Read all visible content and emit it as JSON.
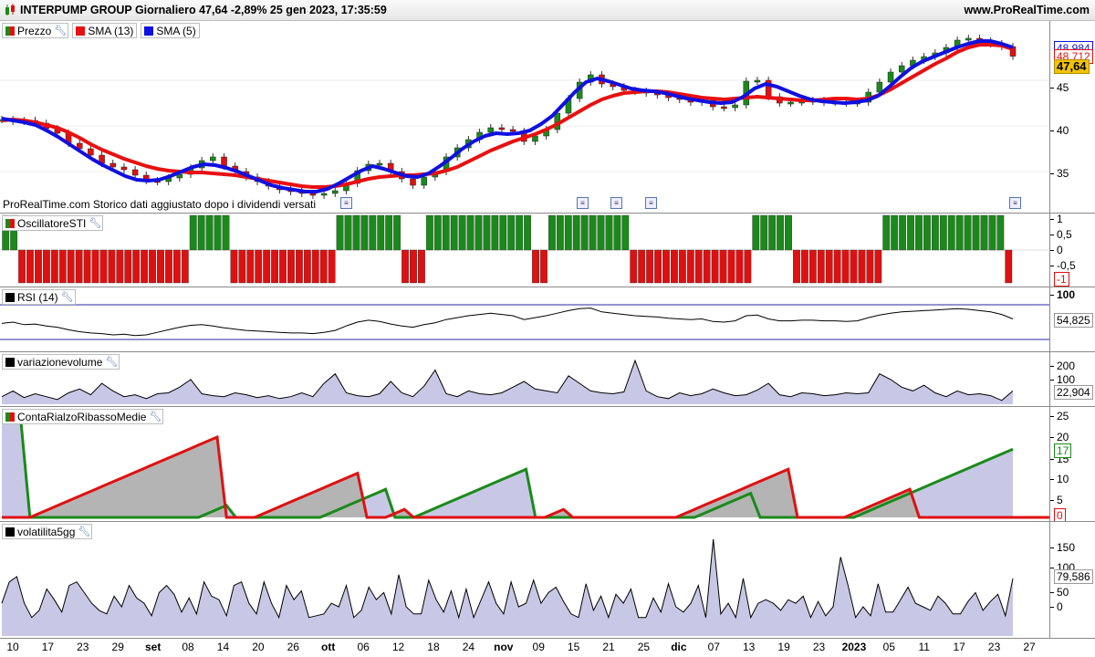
{
  "header": {
    "title": "INTERPUMP GROUP Giornaliero 47,64 -2,89% 25 gen 2023, 17:35:59",
    "site": "www.ProRealTime.com"
  },
  "colors": {
    "up": "#1a8a1a",
    "down": "#e01010",
    "sma13": "#e81010",
    "sma5": "#1010e0",
    "fill": "#c8c8e6"
  },
  "price_panel": {
    "legend": [
      {
        "label": "Prezzo",
        "color": "#1a8a1a"
      },
      {
        "label": "SMA (13)",
        "color": "#e81010"
      },
      {
        "label": "SMA (5)",
        "color": "#1010e0"
      }
    ],
    "footnote": "ProRealTime.com Storico dati aggiustato dopo i dividendi versati",
    "yticks": [
      "45",
      "40",
      "35"
    ],
    "labels": {
      "top": "48,984",
      "mid": "48,712",
      "last": "47,64"
    }
  },
  "sti_panel": {
    "name": "OscillatoreSTI",
    "yticks": [
      "1",
      "0,5",
      "0",
      "-0,5"
    ],
    "last": "-1"
  },
  "rsi_panel": {
    "name": "RSI (14)",
    "yticks": [
      "100"
    ],
    "last": "54,825"
  },
  "vol_panel": {
    "name": "variazionevolume",
    "yticks": [
      "200",
      "100"
    ],
    "last": "22,904"
  },
  "conta_panel": {
    "name": "ContaRialzoRibassoMedie",
    "yticks": [
      "25",
      "20",
      "15",
      "10",
      "5"
    ],
    "last_up": "17",
    "last_down": "0"
  },
  "volat_panel": {
    "name": "volatilita5gg",
    "yticks": [
      "150",
      "100",
      "50",
      "0"
    ],
    "last": "79,586"
  },
  "xaxis": [
    {
      "t": "10",
      "b": false
    },
    {
      "t": "17",
      "b": false
    },
    {
      "t": "23",
      "b": false
    },
    {
      "t": "29",
      "b": false
    },
    {
      "t": "set",
      "b": true
    },
    {
      "t": "08",
      "b": false
    },
    {
      "t": "14",
      "b": false
    },
    {
      "t": "20",
      "b": false
    },
    {
      "t": "26",
      "b": false
    },
    {
      "t": "ott",
      "b": true
    },
    {
      "t": "06",
      "b": false
    },
    {
      "t": "12",
      "b": false
    },
    {
      "t": "18",
      "b": false
    },
    {
      "t": "24",
      "b": false
    },
    {
      "t": "nov",
      "b": true
    },
    {
      "t": "09",
      "b": false
    },
    {
      "t": "15",
      "b": false
    },
    {
      "t": "21",
      "b": false
    },
    {
      "t": "25",
      "b": false
    },
    {
      "t": "dic",
      "b": true
    },
    {
      "t": "07",
      "b": false
    },
    {
      "t": "13",
      "b": false
    },
    {
      "t": "19",
      "b": false
    },
    {
      "t": "23",
      "b": false
    },
    {
      "t": "2023",
      "b": true
    },
    {
      "t": "05",
      "b": false
    },
    {
      "t": "11",
      "b": false
    },
    {
      "t": "17",
      "b": false
    },
    {
      "t": "23",
      "b": false
    },
    {
      "t": "27",
      "b": false
    }
  ],
  "chart_data": [
    {
      "type": "line",
      "title": "INTERPUMP GROUP Giornaliero",
      "ylim": [
        30,
        50
      ],
      "series": [
        {
          "name": "Prezzo",
          "values": [
            40.7,
            40.5,
            40.6,
            40.3,
            39.7,
            39.2,
            38.1,
            37.5,
            36.8,
            35.9,
            35.5,
            35.2,
            34.6,
            34.0,
            33.9,
            34.3,
            34.7,
            35.4,
            36.2,
            36.6,
            35.6,
            35.0,
            34.4,
            33.9,
            33.4,
            33.0,
            32.8,
            32.6,
            32.4,
            32.6,
            32.9,
            33.7,
            35.1,
            35.8,
            35.9,
            35.0,
            34.2,
            33.5,
            34.4,
            35.0,
            36.6,
            37.6,
            38.5,
            39.3,
            39.8,
            39.6,
            39.4,
            38.3,
            38.9,
            39.6,
            41.4,
            43.0,
            44.8,
            45.6,
            44.6,
            44.3,
            43.9,
            43.8,
            43.6,
            43.4,
            43.1,
            42.9,
            42.6,
            42.8,
            42.1,
            42.0,
            42.3,
            44.9,
            45.0,
            43.2,
            42.5,
            42.6,
            42.7,
            42.8,
            42.6,
            42.6,
            42.5,
            42.6,
            43.7,
            44.8,
            45.9,
            46.6,
            47.2,
            47.6,
            48.0,
            48.6,
            49.4,
            49.6,
            49.3,
            49.0,
            48.7,
            47.64
          ]
        },
        {
          "name": "SMA (13)",
          "values": [
            40.6,
            40.7,
            40.6,
            40.4,
            40.1,
            39.8,
            39.3,
            38.7,
            38.0,
            37.4,
            36.9,
            36.4,
            36.0,
            35.6,
            35.3,
            35.1,
            35.0,
            34.9,
            34.9,
            34.8,
            34.7,
            34.6,
            34.4,
            34.2,
            34.0,
            33.8,
            33.6,
            33.4,
            33.3,
            33.3,
            33.4,
            33.6,
            33.9,
            34.2,
            34.4,
            34.5,
            34.6,
            34.6,
            34.7,
            34.8,
            35.1,
            35.5,
            36.1,
            36.7,
            37.3,
            37.8,
            38.3,
            38.7,
            39.1,
            39.6,
            40.2,
            40.9,
            41.6,
            42.3,
            42.9,
            43.3,
            43.6,
            43.7,
            43.8,
            43.8,
            43.7,
            43.5,
            43.3,
            43.1,
            43.0,
            42.9,
            43.0,
            43.1,
            43.2,
            43.1,
            43.0,
            42.9,
            42.8,
            42.8,
            42.9,
            43.0,
            43.0,
            42.9,
            43.0,
            43.4,
            44.0,
            44.7,
            45.4,
            46.1,
            46.8,
            47.4,
            48.1,
            48.6,
            48.9,
            48.9,
            48.8,
            48.4
          ]
        },
        {
          "name": "SMA (5)",
          "values": [
            40.8,
            40.6,
            40.4,
            40.1,
            39.5,
            38.8,
            38.0,
            37.2,
            36.4,
            35.7,
            35.1,
            34.5,
            34.1,
            34.0,
            34.1,
            34.5,
            35.0,
            35.5,
            35.8,
            35.7,
            35.4,
            35.0,
            34.5,
            34.0,
            33.5,
            33.2,
            33.0,
            32.8,
            32.8,
            33.1,
            33.7,
            34.4,
            35.1,
            35.6,
            35.3,
            34.9,
            34.5,
            34.4,
            34.8,
            35.6,
            36.5,
            37.5,
            38.3,
            38.9,
            39.2,
            39.1,
            39.2,
            39.5,
            40.2,
            41.1,
            42.4,
            43.7,
            44.8,
            45.2,
            44.9,
            44.5,
            44.1,
            43.9,
            43.8,
            43.6,
            43.3,
            43.0,
            42.8,
            42.6,
            42.5,
            42.6,
            43.2,
            44.1,
            44.6,
            44.3,
            43.8,
            43.3,
            42.9,
            42.7,
            42.6,
            42.5,
            42.6,
            42.8,
            43.3,
            44.3,
            45.4,
            46.4,
            47.1,
            47.6,
            48.1,
            48.6,
            49.0,
            49.3,
            49.3,
            49.0,
            48.6
          ]
        }
      ]
    },
    {
      "type": "bar",
      "title": "OscillatoreSTI",
      "ylim": [
        -1,
        1
      ],
      "values": [
        1,
        1,
        -1,
        -1,
        -1,
        -1,
        -1,
        -1,
        -1,
        -1,
        -1,
        -1,
        -1,
        -1,
        -1,
        -1,
        -1,
        -1,
        -1,
        -1,
        -1,
        -1,
        -1,
        1,
        1,
        1,
        1,
        1,
        -1,
        -1,
        -1,
        -1,
        -1,
        -1,
        -1,
        -1,
        -1,
        -1,
        -1,
        -1,
        -1,
        1,
        1,
        1,
        1,
        1,
        1,
        1,
        1,
        -1,
        -1,
        -1,
        1,
        1,
        1,
        1,
        1,
        1,
        1,
        1,
        1,
        1,
        1,
        1,
        1,
        -1,
        -1,
        1,
        1,
        1,
        1,
        1,
        1,
        1,
        1,
        1,
        1,
        -1,
        -1,
        -1,
        -1,
        -1,
        -1,
        -1,
        -1,
        -1,
        -1,
        -1,
        -1,
        -1,
        -1,
        -1,
        1,
        1,
        1,
        1,
        1,
        -1,
        -1,
        -1,
        -1,
        -1,
        -1,
        -1,
        -1,
        -1,
        -1,
        -1,
        1,
        1,
        1,
        1,
        1,
        1,
        1,
        1,
        1,
        1,
        1,
        1,
        1,
        1,
        1,
        -1
      ]
    },
    {
      "type": "line",
      "title": "RSI (14)",
      "ylim": [
        0,
        100
      ],
      "series": [
        {
          "name": "RSI (14)",
          "values": [
            48,
            50,
            46,
            47,
            44,
            42,
            38,
            35,
            33,
            32,
            30,
            31,
            29,
            30,
            34,
            38,
            42,
            45,
            46,
            44,
            41,
            39,
            37,
            36,
            35,
            34,
            33,
            33,
            32,
            34,
            37,
            44,
            50,
            53,
            51,
            47,
            44,
            42,
            46,
            49,
            54,
            57,
            60,
            62,
            64,
            62,
            60,
            54,
            57,
            60,
            64,
            68,
            71,
            72,
            66,
            64,
            62,
            60,
            59,
            58,
            56,
            55,
            54,
            55,
            51,
            50,
            52,
            60,
            61,
            55,
            52,
            52,
            53,
            53,
            52,
            52,
            51,
            52,
            57,
            61,
            64,
            66,
            67,
            68,
            69,
            70,
            71,
            70,
            68,
            66,
            62,
            55
          ]
        }
      ]
    },
    {
      "type": "area",
      "title": "variazionevolume",
      "series": [
        {
          "name": "variazionevolume",
          "values": [
            40,
            70,
            35,
            55,
            40,
            25,
            60,
            80,
            50,
            110,
            70,
            40,
            50,
            30,
            55,
            60,
            90,
            130,
            55,
            45,
            40,
            60,
            50,
            35,
            45,
            30,
            40,
            60,
            40,
            110,
            160,
            60,
            45,
            40,
            55,
            120,
            60,
            40,
            95,
            180,
            55,
            40,
            70,
            55,
            50,
            60,
            90,
            120,
            80,
            70,
            60,
            150,
            110,
            70,
            60,
            55,
            65,
            230,
            70,
            40,
            30,
            60,
            45,
            55,
            80,
            60,
            45,
            50,
            75,
            110,
            50,
            40,
            60,
            55,
            45,
            50,
            60,
            55,
            60,
            160,
            130,
            90,
            70,
            100,
            60,
            40,
            70,
            50,
            55,
            45,
            20,
            70
          ]
        }
      ]
    },
    {
      "type": "area",
      "title": "ContaRialzoRibassoMedie",
      "ylim": [
        0,
        25
      ],
      "series": [
        {
          "name": "rialzo",
          "values": [
            25,
            25,
            25,
            0,
            0,
            0,
            0,
            0,
            0,
            0,
            0,
            0,
            0,
            0,
            0,
            0,
            0,
            0,
            0,
            0,
            0,
            0,
            1,
            2,
            3,
            0,
            0,
            0,
            0,
            0,
            0,
            0,
            0,
            0,
            0,
            1,
            2,
            3,
            4,
            5,
            6,
            7,
            0,
            0,
            0,
            1,
            2,
            3,
            4,
            5,
            6,
            7,
            8,
            9,
            10,
            11,
            12,
            0,
            0,
            0,
            0,
            0,
            0,
            0,
            0,
            0,
            0,
            0,
            0,
            0,
            0,
            0,
            0,
            0,
            0,
            1,
            2,
            3,
            4,
            5,
            6,
            0,
            0,
            0,
            0,
            0,
            0,
            0,
            0,
            0,
            0,
            0,
            1,
            2,
            3,
            4,
            5,
            6,
            7,
            8,
            9,
            10,
            11,
            12,
            13,
            14,
            15,
            16,
            17
          ]
        },
        {
          "name": "ribasso",
          "values": [
            0,
            0,
            0,
            0,
            1,
            2,
            3,
            4,
            5,
            6,
            7,
            8,
            9,
            10,
            11,
            12,
            13,
            14,
            15,
            16,
            17,
            18,
            19,
            20,
            0,
            0,
            0,
            0,
            1,
            2,
            3,
            4,
            5,
            6,
            7,
            8,
            9,
            10,
            11,
            0,
            0,
            0,
            1,
            2,
            0,
            0,
            0,
            0,
            0,
            0,
            0,
            0,
            0,
            0,
            0,
            0,
            0,
            0,
            0,
            1,
            2,
            0,
            0,
            0,
            0,
            0,
            0,
            0,
            0,
            0,
            0,
            0,
            0,
            1,
            2,
            3,
            4,
            5,
            6,
            7,
            8,
            9,
            10,
            11,
            12,
            0,
            0,
            0,
            0,
            0,
            0,
            1,
            2,
            3,
            4,
            5,
            6,
            7,
            0,
            0,
            0,
            0,
            0,
            0,
            0,
            0,
            0,
            0,
            0,
            0,
            0,
            0,
            0,
            0
          ]
        }
      ]
    },
    {
      "type": "area",
      "title": "volatilita5gg",
      "series": [
        {
          "name": "volatilita5gg",
          "values": [
            10,
            70,
            85,
            10,
            -30,
            -10,
            50,
            20,
            -15,
            60,
            70,
            40,
            10,
            -10,
            -20,
            30,
            0,
            60,
            25,
            10,
            -25,
            40,
            60,
            35,
            -15,
            25,
            -20,
            70,
            30,
            20,
            -25,
            60,
            70,
            10,
            -20,
            70,
            10,
            -30,
            60,
            20,
            45,
            -30,
            -25,
            -20,
            10,
            0,
            60,
            -30,
            -10,
            55,
            20,
            40,
            -20,
            90,
            0,
            -20,
            -20,
            75,
            20,
            -15,
            45,
            -30,
            50,
            -30,
            20,
            70,
            10,
            -20,
            70,
            0,
            10,
            75,
            10,
            40,
            55,
            15,
            -20,
            -30,
            65,
            -10,
            30,
            -30,
            35,
            10,
            50,
            -30,
            -30,
            25,
            -15,
            65,
            0,
            -15,
            10,
            60,
            -30,
            190,
            -20,
            10,
            -30,
            80,
            -30,
            10,
            20,
            10,
            -10,
            20,
            10,
            30,
            -30,
            15,
            -25,
            0,
            140,
            60,
            -30,
            0,
            -25,
            65,
            -15,
            -15,
            20,
            55,
            10,
            0,
            -10,
            30,
            10,
            -20,
            -20,
            15,
            40,
            -10,
            15,
            35,
            -25,
            80
          ]
        }
      ]
    }
  ]
}
